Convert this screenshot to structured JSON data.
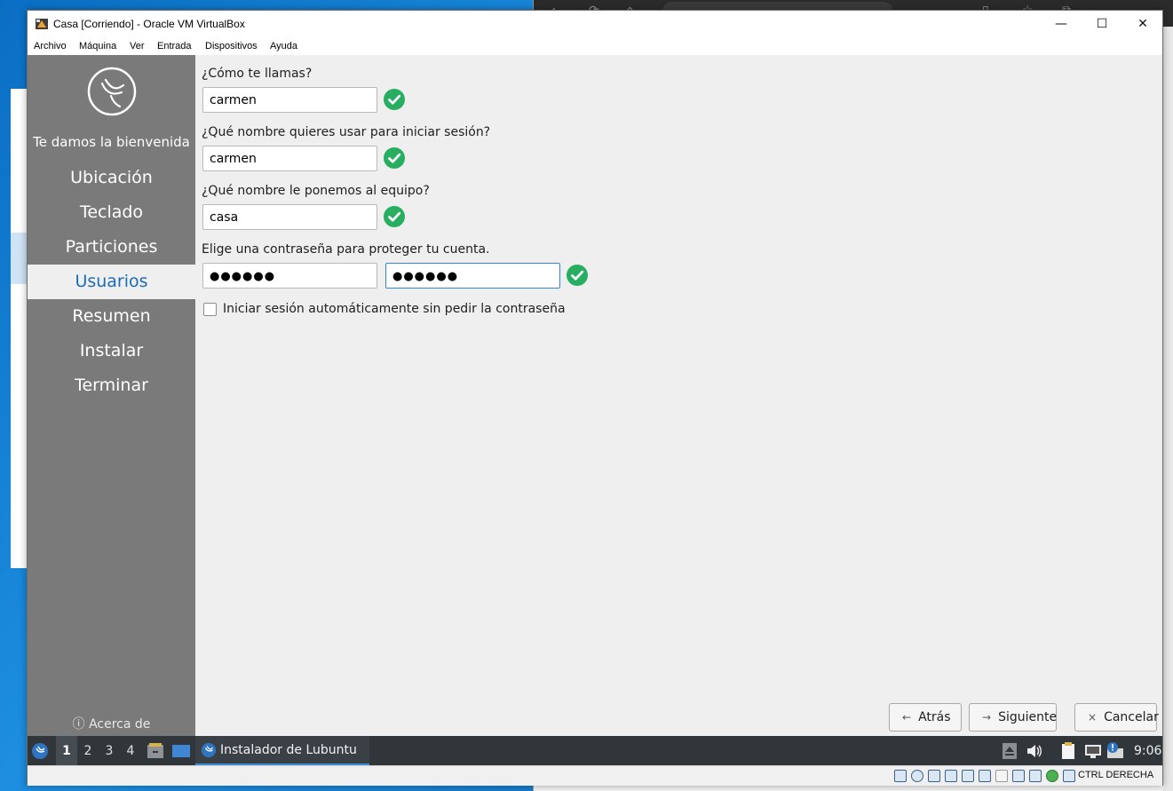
{
  "window": {
    "title": "Casa [Corriendo] - Oracle VM VirtualBox",
    "minimize_glyph": "—",
    "maximize_glyph": "☐",
    "close_glyph": "✕"
  },
  "menubar": {
    "items": [
      "Archivo",
      "Máquina",
      "Ver",
      "Entrada",
      "Dispositivos",
      "Ayuda"
    ]
  },
  "installer": {
    "welcome": "Te damos la bienvenida",
    "steps": [
      "Ubicación",
      "Teclado",
      "Particiones",
      "Usuarios",
      "Resumen",
      "Instalar",
      "Terminar"
    ],
    "active_step": "Usuarios",
    "about_label": "Acerca de",
    "about_glyph": "ⓘ",
    "form": {
      "name_label": "¿Cómo te llamas?",
      "name_value": "carmen",
      "login_label": "¿Qué nombre quieres usar para iniciar sesión?",
      "login_value": "carmen",
      "host_label": "¿Qué nombre le ponemos al equipo?",
      "host_value": "casa",
      "password_label": "Elige una contraseña para proteger tu cuenta.",
      "password_value": "●●●●●●",
      "password_confirm_value": "●●●●●●",
      "autologin_label": "Iniciar sesión automáticamente sin pedir la contraseña",
      "autologin_checked": false
    },
    "buttons": {
      "back_label": "Atrás",
      "back_glyph": "←",
      "next_label": "Siguiente",
      "next_glyph": "→",
      "cancel_label": "Cancelar",
      "cancel_glyph": "×"
    },
    "colors": {
      "sidebar": "#7a7a7a",
      "active_step_text": "#1b6bb7",
      "check_green": "#27ae60"
    }
  },
  "guest_panel": {
    "desktops": [
      "1",
      "2",
      "3",
      "4"
    ],
    "current_desktop": "1",
    "task_label": "Instalador de Lubuntu",
    "clock": "9:06"
  },
  "vbox_status": {
    "host_key_label": "CTRL DERECHA"
  }
}
